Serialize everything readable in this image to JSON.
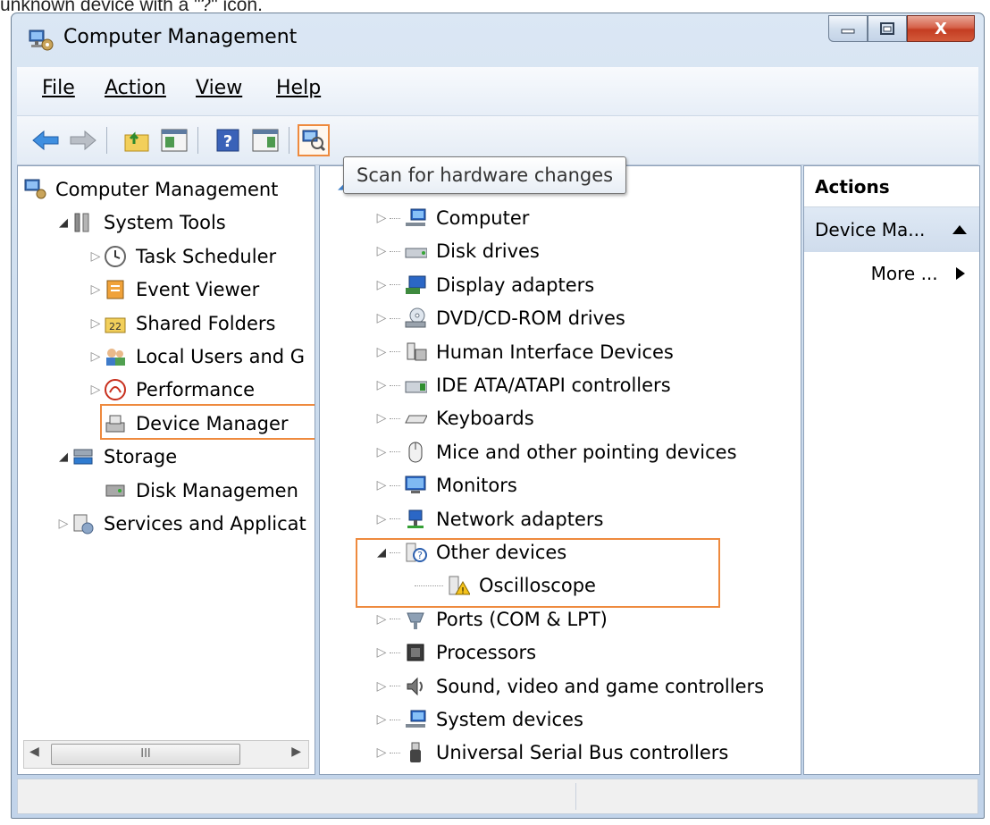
{
  "caption": "unknown device with a \"?\" icon.",
  "window": {
    "title": "Computer Management",
    "controls": {
      "minimize": "minimize",
      "maximize": "maximize",
      "close": "X"
    }
  },
  "menu": [
    {
      "label": "File"
    },
    {
      "label": "Action"
    },
    {
      "label": "View"
    },
    {
      "label": "Help"
    }
  ],
  "toolbar": {
    "icons": [
      "back-arrow-icon",
      "forward-arrow-icon",
      "up-folder-icon",
      "show-hide-tree-icon",
      "help-icon",
      "show-hide-action-pane-icon",
      "scan-hardware-icon"
    ],
    "tooltip": "Scan for hardware changes"
  },
  "left_tree": [
    {
      "label": "Computer Management",
      "icon": "computer-management-icon",
      "level": 0,
      "expander": "none"
    },
    {
      "label": "System Tools",
      "icon": "tools-icon",
      "level": 1,
      "expander": "open"
    },
    {
      "label": "Task Scheduler",
      "icon": "clock-icon",
      "level": 2,
      "expander": "closed"
    },
    {
      "label": "Event Viewer",
      "icon": "event-viewer-icon",
      "level": 2,
      "expander": "closed"
    },
    {
      "label": "Shared Folders",
      "icon": "shared-folders-icon",
      "level": 2,
      "expander": "closed"
    },
    {
      "label": "Local Users and G",
      "icon": "users-icon",
      "level": 2,
      "expander": "closed"
    },
    {
      "label": "Performance",
      "icon": "performance-icon",
      "level": 2,
      "expander": "closed"
    },
    {
      "label": "Device Manager",
      "icon": "device-manager-icon",
      "level": 2,
      "expander": "none",
      "selected": true
    },
    {
      "label": "Storage",
      "icon": "storage-icon",
      "level": 1,
      "expander": "open"
    },
    {
      "label": "Disk Managemen",
      "icon": "disk-icon",
      "level": 2,
      "expander": "none"
    },
    {
      "label": "Services and Applicat",
      "icon": "services-icon",
      "level": 1,
      "expander": "closed"
    }
  ],
  "hscroll_grip": "III",
  "device_tree": [
    {
      "label": "Computer",
      "icon": "computer-icon"
    },
    {
      "label": "Disk drives",
      "icon": "disk-drive-icon"
    },
    {
      "label": "Display adapters",
      "icon": "display-adapter-icon"
    },
    {
      "label": "DVD/CD-ROM drives",
      "icon": "dvd-icon"
    },
    {
      "label": "Human Interface Devices",
      "icon": "hid-icon"
    },
    {
      "label": "IDE ATA/ATAPI controllers",
      "icon": "ide-icon"
    },
    {
      "label": "Keyboards",
      "icon": "keyboard-icon"
    },
    {
      "label": "Mice and other pointing devices",
      "icon": "mouse-icon"
    },
    {
      "label": "Monitors",
      "icon": "monitor-icon"
    },
    {
      "label": "Network adapters",
      "icon": "network-icon"
    },
    {
      "label": "Other devices",
      "icon": "unknown-device-icon",
      "expanded": true
    },
    {
      "label": "Oscilloscope",
      "icon": "warning-device-icon",
      "child": true
    },
    {
      "label": "Ports (COM & LPT)",
      "icon": "port-icon"
    },
    {
      "label": "Processors",
      "icon": "processor-icon"
    },
    {
      "label": "Sound, video and game controllers",
      "icon": "speaker-icon"
    },
    {
      "label": "System devices",
      "icon": "system-devices-icon"
    },
    {
      "label": "Universal Serial Bus controllers",
      "icon": "usb-icon"
    }
  ],
  "actions": {
    "header": "Actions",
    "section": "Device Ma...",
    "more": "More ..."
  },
  "accent": "#ee8a3e"
}
